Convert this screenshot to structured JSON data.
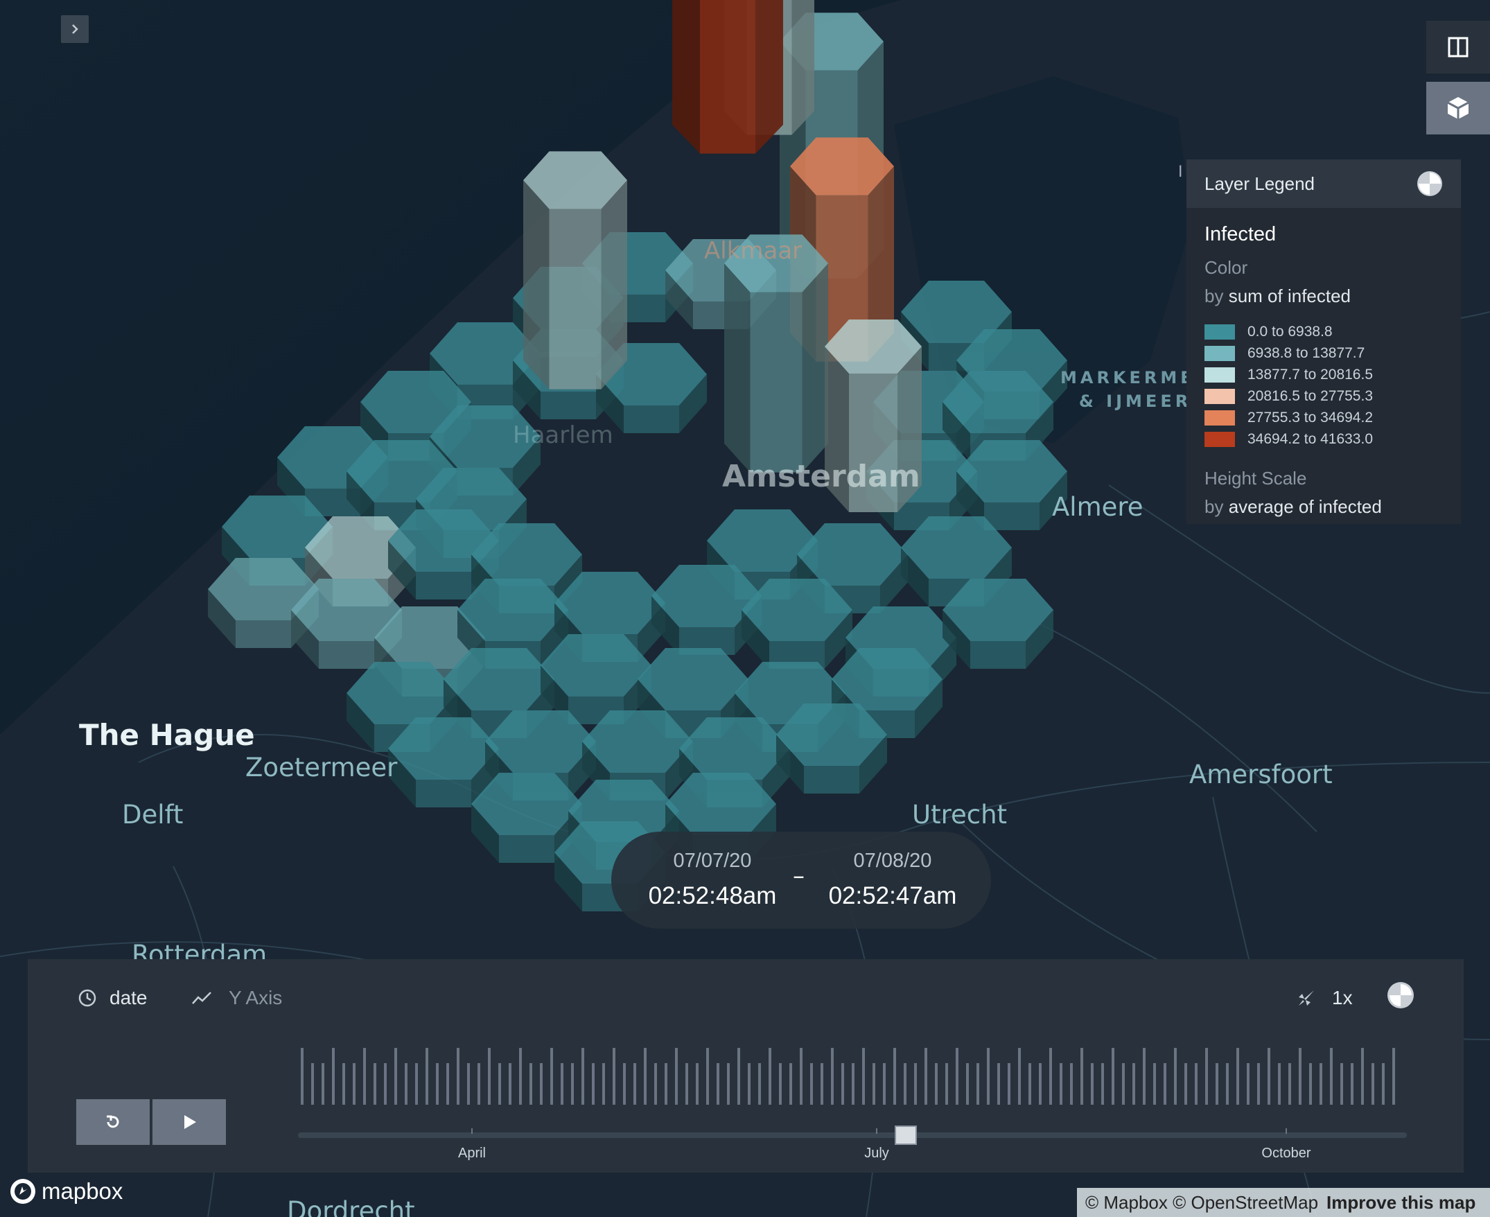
{
  "map": {
    "cities": {
      "the_hague": "The Hague",
      "zoetermeer": "Zoetermeer",
      "delft": "Delft",
      "rotterdam": "Rotterdam",
      "dordrecht": "Dordrecht",
      "utrecht": "Utrecht",
      "amersfoort": "Amersfoort",
      "almere": "Almere",
      "amsterdam": "Amsterdam",
      "alkmaar": "Alkmaar",
      "haarlem": "Haarlem"
    },
    "water": {
      "line1": "MARKERMEE",
      "line2": "& IJMEER"
    },
    "legend_collapsed_marker": "I"
  },
  "hexagon_layer": {
    "metric": "infected",
    "color_aggregation": "sum",
    "height_aggregation": "average",
    "color_scale": [
      "#3d8f9a",
      "#76b7bf",
      "#bfe0e0",
      "#f3c3ac",
      "#e4825a",
      "#b83c1d"
    ]
  },
  "legend": {
    "title": "Layer Legend",
    "layer_name": "Infected",
    "color_heading": "Color",
    "color_by_prefix": "by",
    "color_by_field": "sum of infected",
    "ranges": [
      {
        "label": "0.0 to 6938.8",
        "color": "#3d8f9a"
      },
      {
        "label": "6938.8 to 13877.7",
        "color": "#76b7bf"
      },
      {
        "label": "13877.7 to 20816.5",
        "color": "#bfe0e0"
      },
      {
        "label": "20816.5 to 27755.3",
        "color": "#f3c3ac"
      },
      {
        "label": "27755.3 to 34694.2",
        "color": "#e4825a"
      },
      {
        "label": "34694.2 to 41633.0",
        "color": "#b83c1d"
      }
    ],
    "height_heading": "Height Scale",
    "height_by_prefix": "by",
    "height_by_field": "average of infected"
  },
  "time_window": {
    "start_date": "07/07/20",
    "start_time": "02:52:48am",
    "separator": "–",
    "end_date": "07/08/20",
    "end_time": "02:52:47am"
  },
  "timeline": {
    "field_label": "date",
    "y_axis_label": "Y Axis",
    "speed_label": "1x",
    "months": [
      "April",
      "July",
      "October"
    ],
    "handle_position": 0.548
  },
  "attribution": {
    "logo": "mapbox",
    "text": "© Mapbox © OpenStreetMap",
    "improve": "Improve this map"
  },
  "colors": {
    "background": "#0f1a24",
    "panel": "#29323c",
    "accent_teal": "#3d8f9a"
  }
}
